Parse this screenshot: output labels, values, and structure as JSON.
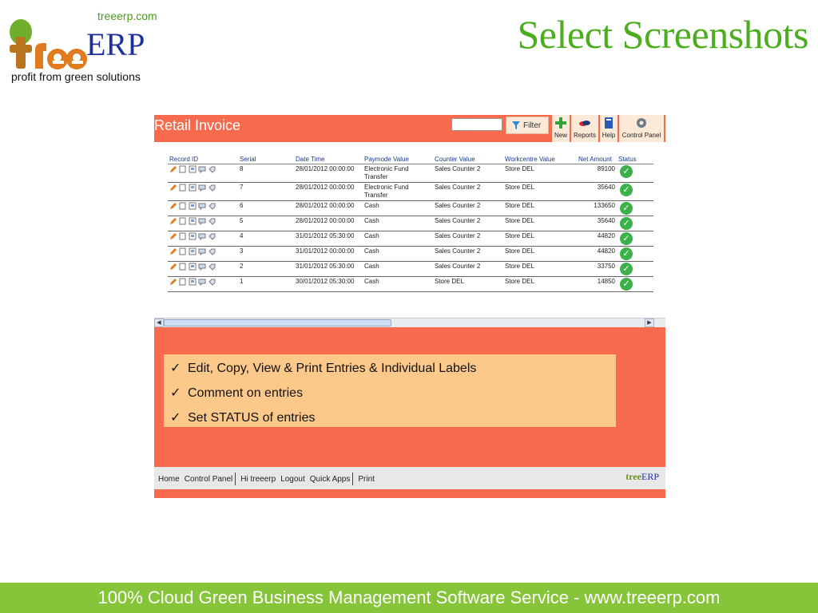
{
  "logo": {
    "url": "treeerp.com",
    "brand_tree": "tree",
    "brand_erp": "ERP",
    "tagline": "profit from green solutions"
  },
  "slide_title": "Select Screenshots",
  "app": {
    "title": "Retail Invoice",
    "search_value": "",
    "filter_label": "Filter",
    "toolbar": [
      {
        "label": "New",
        "icon": "plus-icon"
      },
      {
        "label": "Reports",
        "icon": "reports-icon"
      },
      {
        "label": "Help",
        "icon": "help-book-icon"
      },
      {
        "label": "Control Panel",
        "icon": "gear-icon"
      }
    ],
    "columns": [
      "Record ID",
      "Serial",
      "Date Time",
      "Paymode Value",
      "Counter Value",
      "Workcentre Value",
      "Net Amount",
      "Status"
    ],
    "rows": [
      {
        "serial": "8",
        "datetime": "28/01/2012 00:00:00",
        "paymode": "Electronic Fund Transfer",
        "counter": "Sales Counter 2",
        "workcentre": "Store DEL",
        "amount": "89100"
      },
      {
        "serial": "7",
        "datetime": "28/01/2012 00:00:00",
        "paymode": "Electronic Fund Transfer",
        "counter": "Sales Counter 2",
        "workcentre": "Store DEL",
        "amount": "35640"
      },
      {
        "serial": "6",
        "datetime": "28/01/2012 00:00:00",
        "paymode": "Cash",
        "counter": "Sales Counter 2",
        "workcentre": "Store DEL",
        "amount": "133650"
      },
      {
        "serial": "5",
        "datetime": "28/01/2012 00:00:00",
        "paymode": "Cash",
        "counter": "Sales Counter 2",
        "workcentre": "Store DEL",
        "amount": "35640"
      },
      {
        "serial": "4",
        "datetime": "31/01/2012 05:30:00",
        "paymode": "Cash",
        "counter": "Sales Counter 2",
        "workcentre": "Store DEL",
        "amount": "44820"
      },
      {
        "serial": "3",
        "datetime": "31/01/2012 00:00:00",
        "paymode": "Cash",
        "counter": "Sales Counter 2",
        "workcentre": "Store DEL",
        "amount": "44820"
      },
      {
        "serial": "2",
        "datetime": "31/01/2012 05:30:00",
        "paymode": "Cash",
        "counter": "Sales Counter 2",
        "workcentre": "Store DEL",
        "amount": "33750"
      },
      {
        "serial": "1",
        "datetime": "30/01/2012 05:30:00",
        "paymode": "Cash",
        "counter": "Store DEL",
        "workcentre": "Store DEL",
        "amount": "14850"
      }
    ],
    "row_actions": [
      "edit-pencil-icon",
      "copy-icon",
      "view-icon",
      "comment-icon",
      "label-tag-icon"
    ],
    "status_icon": "check-circle-icon",
    "features": [
      "Edit, Copy, View & Print Entries & Individual Labels",
      "Comment on entries",
      "Set STATUS of entries"
    ],
    "footer_links": [
      "Home",
      "Control Panel",
      "Hi treeerp",
      "Logout",
      "Quick Apps",
      "Print"
    ],
    "footer_logo": {
      "tree": "tree",
      "erp": "ERP"
    }
  },
  "bottom_banner": "100% Cloud Green Business Management Software Service - www.treeerp.com",
  "colors": {
    "app_bg": "#f76a4e",
    "feature_box": "#fdc98a",
    "brand_green": "#4cae1e",
    "brand_blue": "#1f2f9a",
    "banner_green": "#86c43a"
  }
}
